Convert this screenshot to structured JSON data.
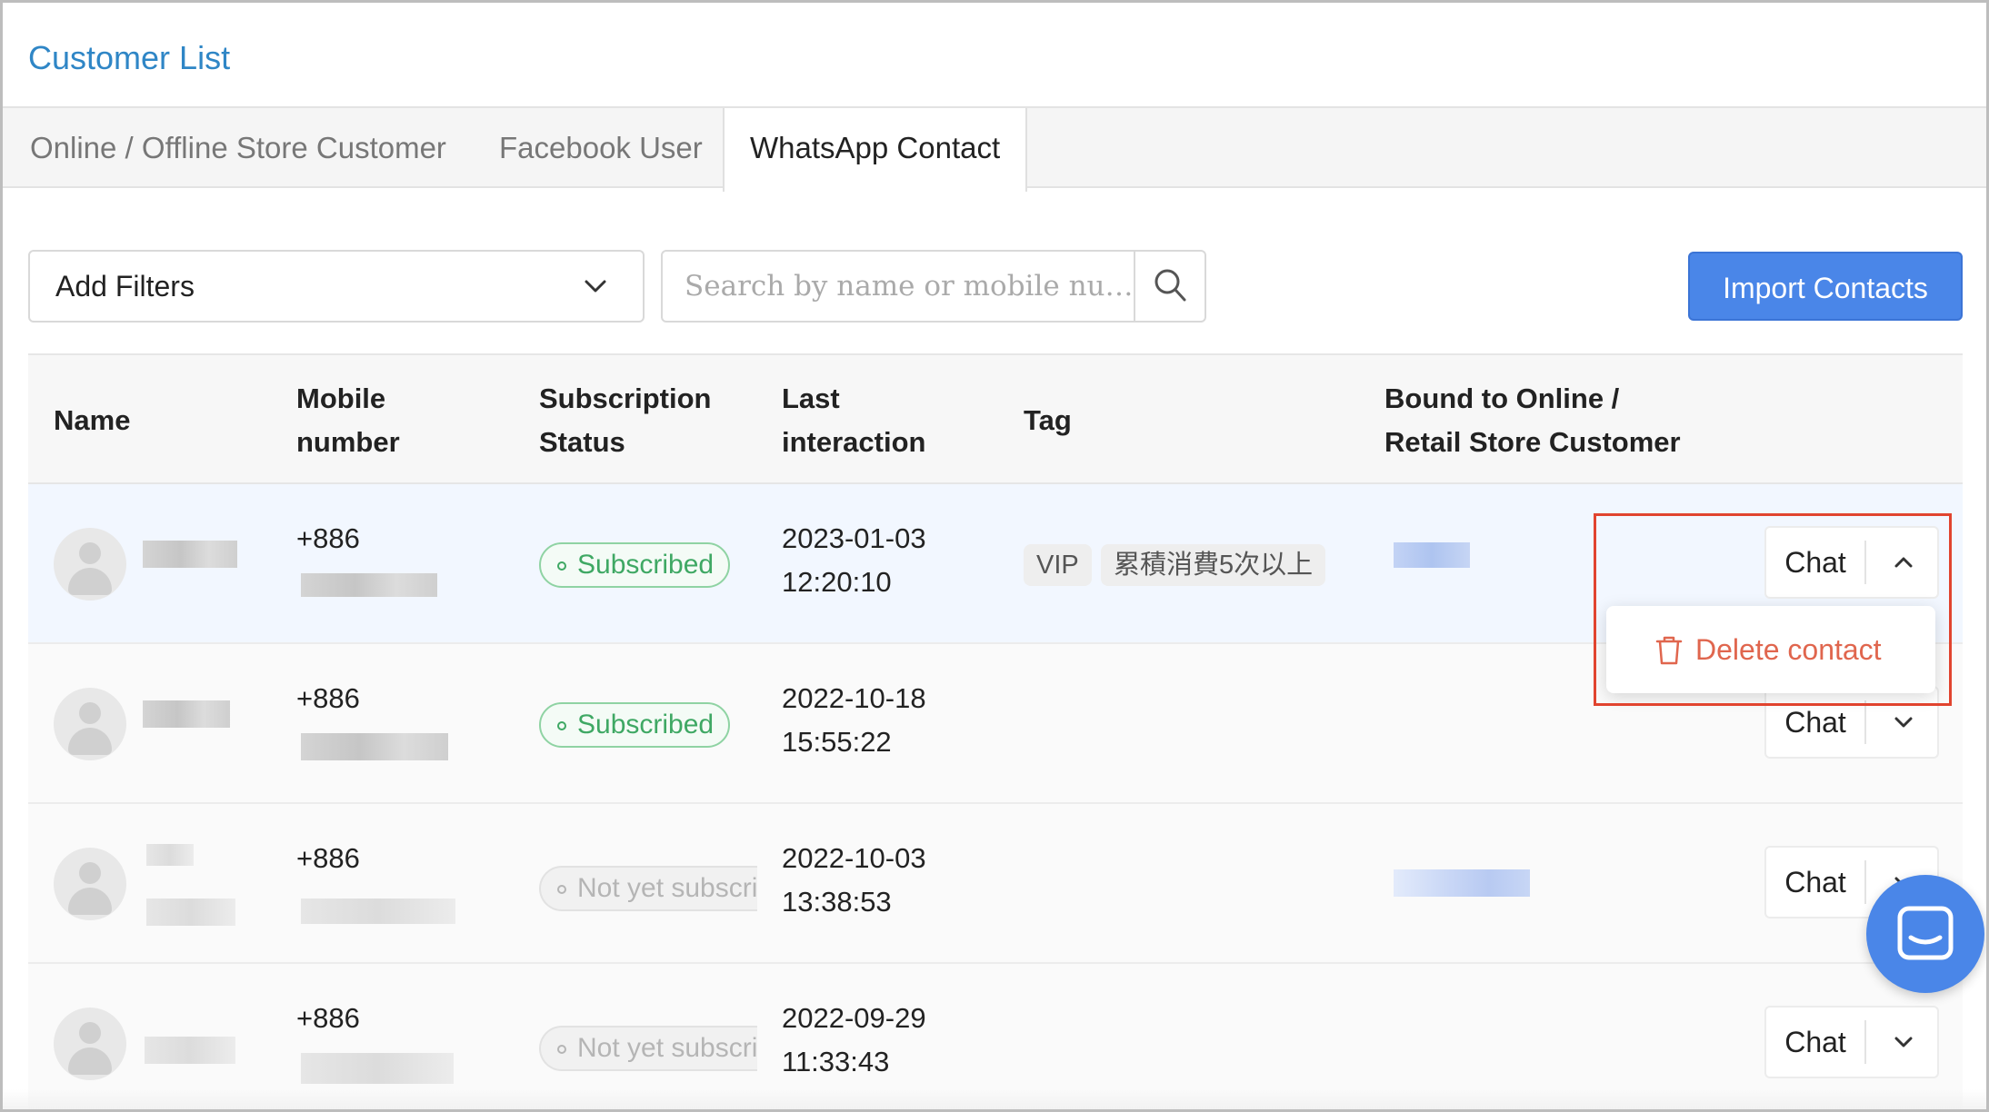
{
  "page": {
    "title": "Customer List"
  },
  "tabs": [
    {
      "label": "Online / Offline Store Customer",
      "active": false
    },
    {
      "label": "Facebook User",
      "active": false
    },
    {
      "label": "WhatsApp Contact",
      "active": true
    }
  ],
  "toolbar": {
    "filter_label": "Add Filters",
    "search_placeholder": "Search by name or mobile nu…",
    "import_label": "Import Contacts"
  },
  "table": {
    "columns": {
      "name": "Name",
      "mobile_line1": "Mobile",
      "mobile_line2": "number",
      "subscription_line1": "Subscription",
      "subscription_line2": "Status",
      "last_line1": "Last",
      "last_line2": "interaction",
      "tag": "Tag",
      "bound_line1": "Bound to Online /",
      "bound_line2": "Retail Store Customer"
    },
    "rows": [
      {
        "mobile_prefix": "+886",
        "subscription": "Subscribed",
        "date": "2023-01-03",
        "time": "12:20:10",
        "tags": [
          "VIP",
          "累積消費5次以上"
        ],
        "chat_label": "Chat",
        "menu_open": true
      },
      {
        "mobile_prefix": "+886",
        "subscription": "Subscribed",
        "date": "2022-10-18",
        "time": "15:55:22",
        "tags": [],
        "chat_label": "Chat",
        "menu_open": false
      },
      {
        "mobile_prefix": "+886",
        "subscription": "Not yet subscribed",
        "date": "2022-10-03",
        "time": "13:38:53",
        "tags": [],
        "chat_label": "Chat",
        "menu_open": false
      },
      {
        "mobile_prefix": "+886",
        "subscription": "Not yet subscribed",
        "date": "2022-09-29",
        "time": "11:33:43",
        "tags": [],
        "chat_label": "Chat",
        "menu_open": false
      }
    ]
  },
  "row_menu": {
    "delete_label": "Delete contact"
  },
  "colors": {
    "title": "#2f86c6",
    "primary": "#4a86e8",
    "subscribed": "#3fa864",
    "danger": "#e0664e",
    "highlight": "#e1442f"
  },
  "icons": {
    "filter_dropdown": "chevron-down-icon",
    "search": "search-icon",
    "expand_open": "chevron-up-icon",
    "expand_closed": "chevron-down-icon",
    "delete": "trash-icon",
    "chat_widget": "chat-bubble-icon",
    "avatar": "user-avatar-icon"
  }
}
